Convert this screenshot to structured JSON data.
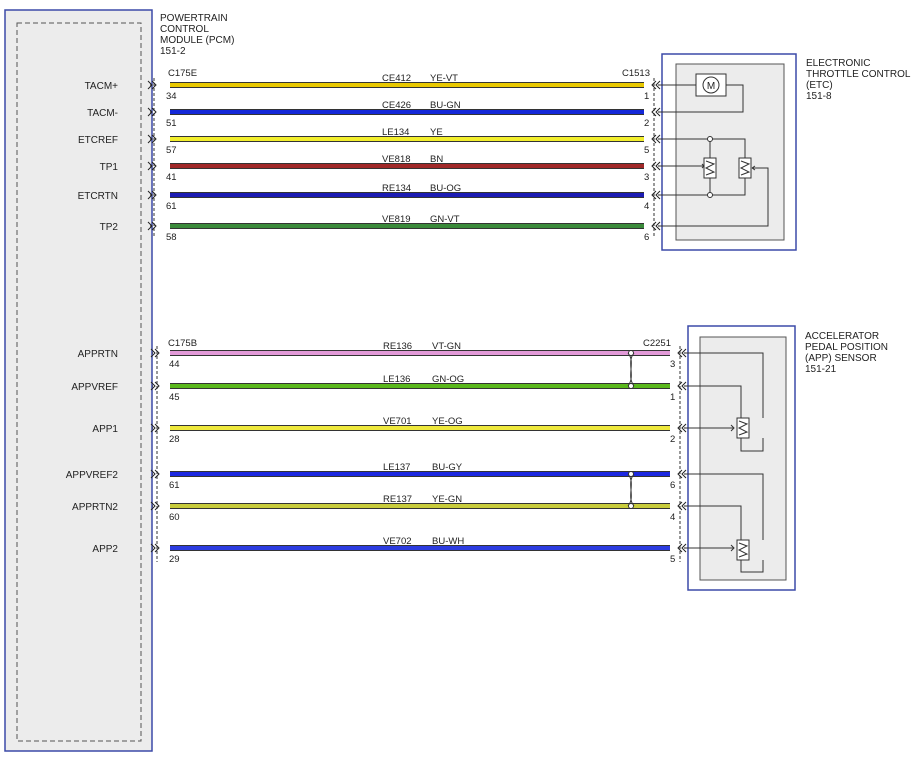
{
  "pcm": {
    "title_lines": [
      "POWERTRAIN",
      "CONTROL",
      "MODULE (PCM)",
      "151-2"
    ]
  },
  "etc": {
    "title_lines": [
      "ELECTRONIC",
      "THROTTLE CONTROL",
      "(ETC)",
      "151-8"
    ],
    "motor_label": "M"
  },
  "app": {
    "title_lines": [
      "ACCELERATOR",
      "PEDAL POSITION",
      "(APP) SENSOR",
      "151-21"
    ]
  },
  "connectors": {
    "pcm_top": "C175E",
    "etc": "C1513",
    "pcm_bottom": "C175B",
    "app": "C2251"
  },
  "colors": {
    "YE-VT": "#e8c800",
    "BU-GN": "#1428d8",
    "YE": "#f2ee2c",
    "BN": "#a02828",
    "BU-OG": "#1c1cb4",
    "GN-VT": "#3a8a3a",
    "VT-GN": "#e29ad8",
    "GN-OG": "#5ab81c",
    "YE-OG": "#eee83c",
    "BU-GY": "#1c28e0",
    "YE-GN": "#c8cc3c",
    "BU-WH": "#2c3ce0",
    "module_border": "#3c4aa8",
    "inner_box_fill": "#ececec"
  },
  "circuits_top": [
    {
      "pin_name": "TACM+",
      "circuit": "CE412",
      "color": "YE-VT",
      "pcm_pin": "34",
      "dev_pin": "1"
    },
    {
      "pin_name": "TACM-",
      "circuit": "CE426",
      "color": "BU-GN",
      "pcm_pin": "51",
      "dev_pin": "2"
    },
    {
      "pin_name": "ETCREF",
      "circuit": "LE134",
      "color": "YE",
      "pcm_pin": "57",
      "dev_pin": "5"
    },
    {
      "pin_name": "TP1",
      "circuit": "VE818",
      "color": "BN",
      "pcm_pin": "41",
      "dev_pin": "3"
    },
    {
      "pin_name": "ETCRTN",
      "circuit": "RE134",
      "color": "BU-OG",
      "pcm_pin": "61",
      "dev_pin": "4"
    },
    {
      "pin_name": "TP2",
      "circuit": "VE819",
      "color": "GN-VT",
      "pcm_pin": "58",
      "dev_pin": "6"
    }
  ],
  "circuits_bottom": [
    {
      "pin_name": "APPRTN",
      "circuit": "RE136",
      "color": "VT-GN",
      "pcm_pin": "44",
      "dev_pin": "3"
    },
    {
      "pin_name": "APPVREF",
      "circuit": "LE136",
      "color": "GN-OG",
      "pcm_pin": "45",
      "dev_pin": "1"
    },
    {
      "pin_name": "APP1",
      "circuit": "VE701",
      "color": "YE-OG",
      "pcm_pin": "28",
      "dev_pin": "2"
    },
    {
      "pin_name": "APPVREF2",
      "circuit": "LE137",
      "color": "BU-GY",
      "pcm_pin": "61",
      "dev_pin": "6"
    },
    {
      "pin_name": "APPRTN2",
      "circuit": "RE137",
      "color": "YE-GN",
      "pcm_pin": "60",
      "dev_pin": "4"
    },
    {
      "pin_name": "APP2",
      "circuit": "VE702",
      "color": "BU-WH",
      "pcm_pin": "29",
      "dev_pin": "5"
    }
  ]
}
